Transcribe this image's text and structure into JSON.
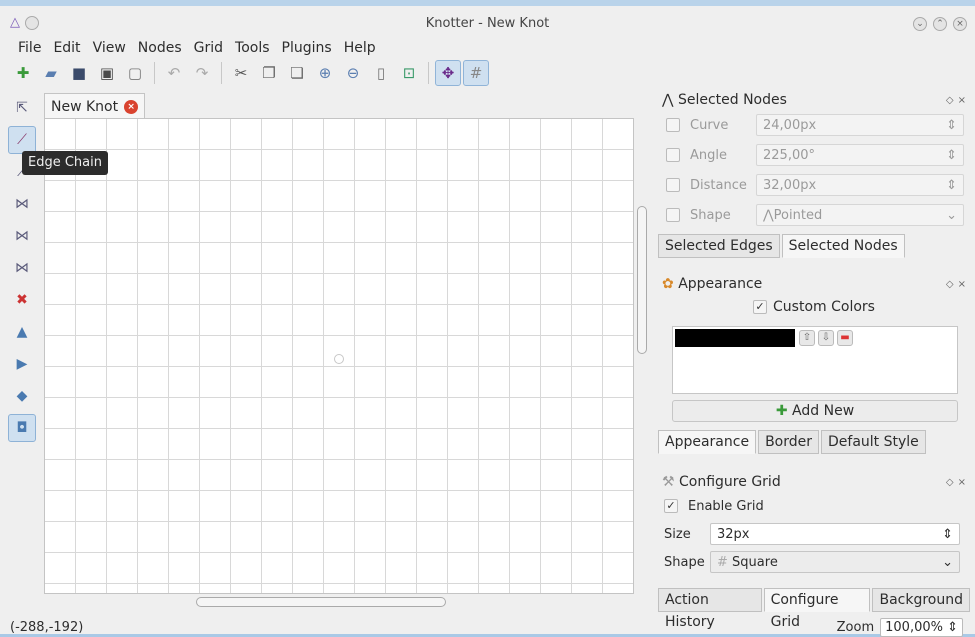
{
  "window": {
    "title": "Knotter - New Knot"
  },
  "menu": [
    "File",
    "Edit",
    "View",
    "Nodes",
    "Grid",
    "Tools",
    "Plugins",
    "Help"
  ],
  "toolbar_icons": [
    "new-file-icon",
    "open-icon",
    "save-icon",
    "save-as-icon",
    "export-icon",
    "undo-icon",
    "redo-icon",
    "cut-icon",
    "copy-icon",
    "paste-icon",
    "zoom-in-icon",
    "zoom-out-icon",
    "page-icon",
    "fit-icon",
    "snap-nodes-icon",
    "grid-icon"
  ],
  "left_tools": [
    "select-icon",
    "edge-chain-icon",
    "merge-icon",
    "insert-node-icon",
    "link-icon",
    "unlink-icon",
    "erase-icon",
    "flip-vertical-icon",
    "flip-horizontal-icon",
    "rotate-icon",
    "scale-icon"
  ],
  "tooltip": "Edge Chain",
  "doc_tab": {
    "label": "New Knot"
  },
  "status": {
    "coords": "(-288,-192)",
    "zoom_label": "Zoom",
    "zoom_value": "100,00%"
  },
  "selected_nodes": {
    "title": "Selected Nodes",
    "rows": [
      {
        "label": "Curve",
        "value": "24,00px"
      },
      {
        "label": "Angle",
        "value": "225,00°"
      },
      {
        "label": "Distance",
        "value": "32,00px"
      },
      {
        "label": "Shape",
        "value": "Pointed"
      }
    ],
    "tabs": [
      "Selected Edges",
      "Selected Nodes"
    ]
  },
  "appearance": {
    "title": "Appearance",
    "custom_colors": "Custom Colors",
    "add_new": "Add New",
    "tabs": [
      "Appearance",
      "Border",
      "Default Style"
    ]
  },
  "configure_grid": {
    "title": "Configure Grid",
    "enable": "Enable Grid",
    "size_label": "Size",
    "size_value": "32px",
    "shape_label": "Shape",
    "shape_value": "Square",
    "tabs": [
      "Action History",
      "Configure Grid",
      "Background"
    ]
  }
}
